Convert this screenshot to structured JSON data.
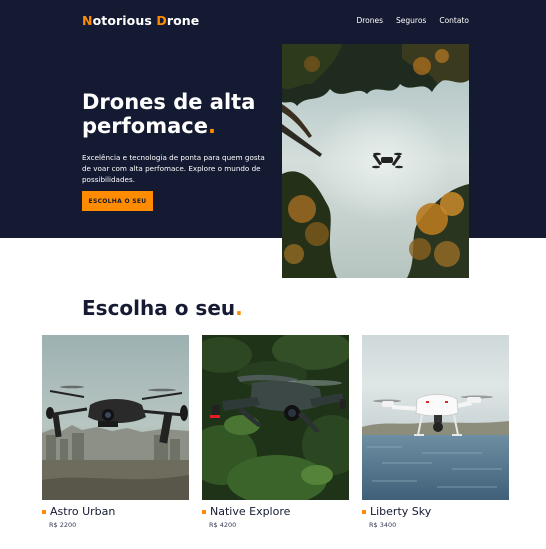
{
  "brand": {
    "part1_initial": "N",
    "part1_rest": "otorious ",
    "part2_initial": "D",
    "part2_rest": "rone"
  },
  "nav": {
    "items": [
      "Drones",
      "Seguros",
      "Contato"
    ]
  },
  "hero": {
    "title": "Drones de alta perfomace",
    "title_dot": ".",
    "description": "Excelência e tecnologia de ponta para quem gosta de voar com alta perfomace. Explore o mundo de possibilidades.",
    "cta_label": "ESCOLHA O SEU"
  },
  "products_section": {
    "title": "Escolha o seu",
    "title_dot": "."
  },
  "products": [
    {
      "name": "Astro Urban",
      "price": "R$ 2200"
    },
    {
      "name": "Native Explore",
      "price": "R$ 4200"
    },
    {
      "name": "Liberty Sky",
      "price": "R$ 3400"
    }
  ],
  "colors": {
    "navy": "#151a33",
    "accent": "#ff8c00",
    "white": "#ffffff"
  }
}
